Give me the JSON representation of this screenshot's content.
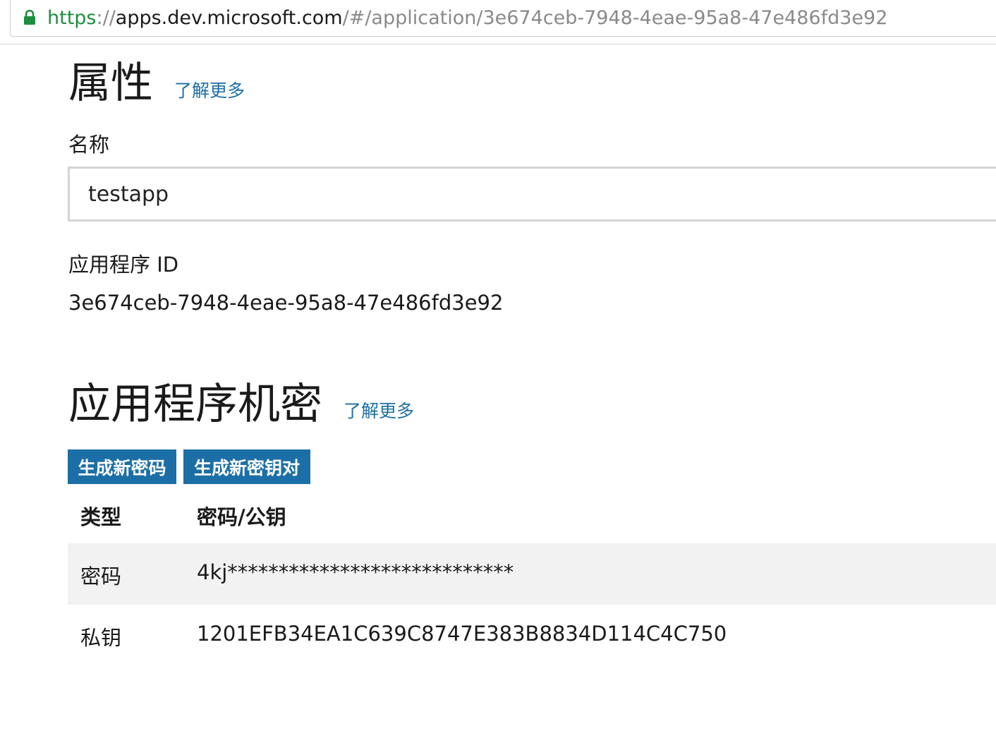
{
  "browser": {
    "url_scheme": "https",
    "url_separator": "://",
    "url_host": "apps.dev.microsoft.com",
    "url_path": "/#/application/3e674ceb-7948-4eae-95a8-47e486fd3e92",
    "lock_icon": "lock-icon",
    "lock_color": "#1e8e3e"
  },
  "properties": {
    "title": "属性",
    "learn_more": "了解更多",
    "name_label": "名称",
    "name_value": "testapp",
    "app_id_label": "应用程序 ID",
    "app_id_value": "3e674ceb-7948-4eae-95a8-47e486fd3e92"
  },
  "secrets": {
    "title": "应用程序机密",
    "learn_more": "了解更多",
    "generate_password_label": "生成新密码",
    "generate_keypair_label": "生成新密钥对",
    "columns": [
      "类型",
      "密码/公钥"
    ],
    "rows": [
      {
        "type": "密码",
        "value": "4kj****************************"
      },
      {
        "type": "私钥",
        "value": "1201EFB34EA1C639C8747E383B8834D114C4C750"
      }
    ]
  },
  "colors": {
    "accent": "#1c6fa6",
    "row_shade": "#f2f2f2"
  }
}
